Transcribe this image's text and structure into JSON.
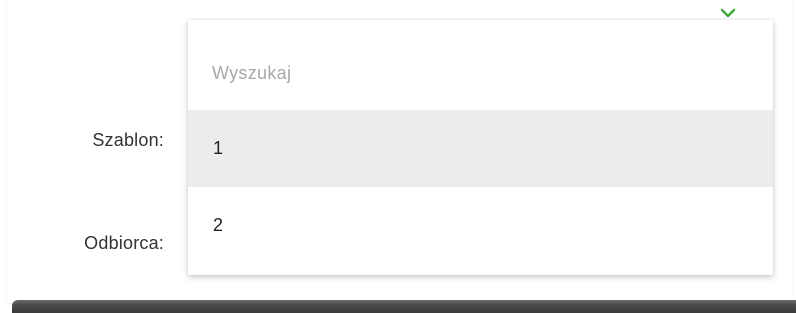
{
  "form": {
    "template_label": "Szablon:",
    "recipient_label": "Odbiorca:"
  },
  "dropdown": {
    "toggle_icon": "chevron-down-icon",
    "toggle_color": "#3aaa35",
    "search_placeholder": "Wyszukaj",
    "search_value": "",
    "options": [
      {
        "label": "1",
        "highlighted": true
      },
      {
        "label": "2",
        "highlighted": false
      }
    ],
    "highlight_color": "#ececec"
  }
}
